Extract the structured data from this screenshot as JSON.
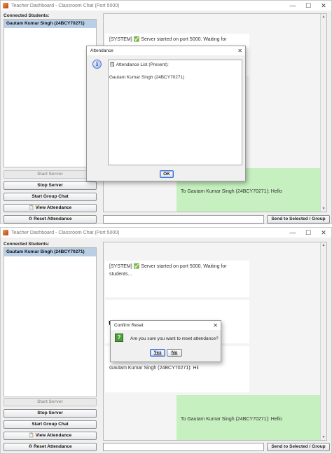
{
  "window1": {
    "title": "Teacher Dashboard - Classroom Chat (Port 5000)",
    "minimize": "—",
    "maximize": "☐",
    "close": "✕",
    "connected_label": "Connected Students:",
    "students": [
      "Gautam Kumar Singh (24BCY70271)"
    ],
    "buttons": {
      "start_server": "Start Server",
      "stop_server": "Stop Server",
      "start_group_chat": "Start Group Chat",
      "view_attendance": "View Attendance",
      "reset_attendance": "Reset Attendance"
    },
    "messages": [
      {
        "text": "[SYSTEM] ✅ Server started on port 5000. Waiting for",
        "kind": "received"
      },
      {
        "text": "To Gautam Kumar Singh (24BCY70271): Hello",
        "kind": "sent"
      }
    ],
    "send_button": "Send to Selected / Group",
    "dialog": {
      "title": "Attendance",
      "close": "✕",
      "icon": "i",
      "content": "🗒 Attendance List (Present):\n\nGautam Kumar Singh (24BCY70271)",
      "ok": "OK"
    }
  },
  "window2": {
    "title": "Teacher Dashboard - Classroom Chat (Port 5000)",
    "minimize": "—",
    "maximize": "☐",
    "close": "✕",
    "connected_label": "Connected Students:",
    "students": [
      "Gautam Kumar Singh (24BCY70271)"
    ],
    "buttons": {
      "start_server": "Start Server",
      "stop_server": "Stop Server",
      "start_group_chat": "Start Group Chat",
      "view_attendance": "View Attendance",
      "reset_attendance": "Reset Attendance"
    },
    "messages": [
      {
        "text": "[SYSTEM] ✅ Server started on port 5000. Waiting for\nstudents...",
        "kind": "received"
      },
      {
        "text": "Gautam Kumar Singh (24BCY70271): Hii",
        "kind": "received"
      },
      {
        "text": "To Gautam Kumar Singh (24BCY70271): Hello",
        "kind": "sent"
      }
    ],
    "send_button": "Send to Selected / Group",
    "dialog": {
      "title": "Confirm Reset",
      "close": "✕",
      "icon": "?",
      "question": "Are you sure you want to reset attendance?",
      "yes": "Yes",
      "no": "No"
    }
  },
  "colors": {
    "selected_row": "#b8cfe5",
    "sent_bubble": "#c7f0c0",
    "window_bg": "#f0f0f0"
  }
}
